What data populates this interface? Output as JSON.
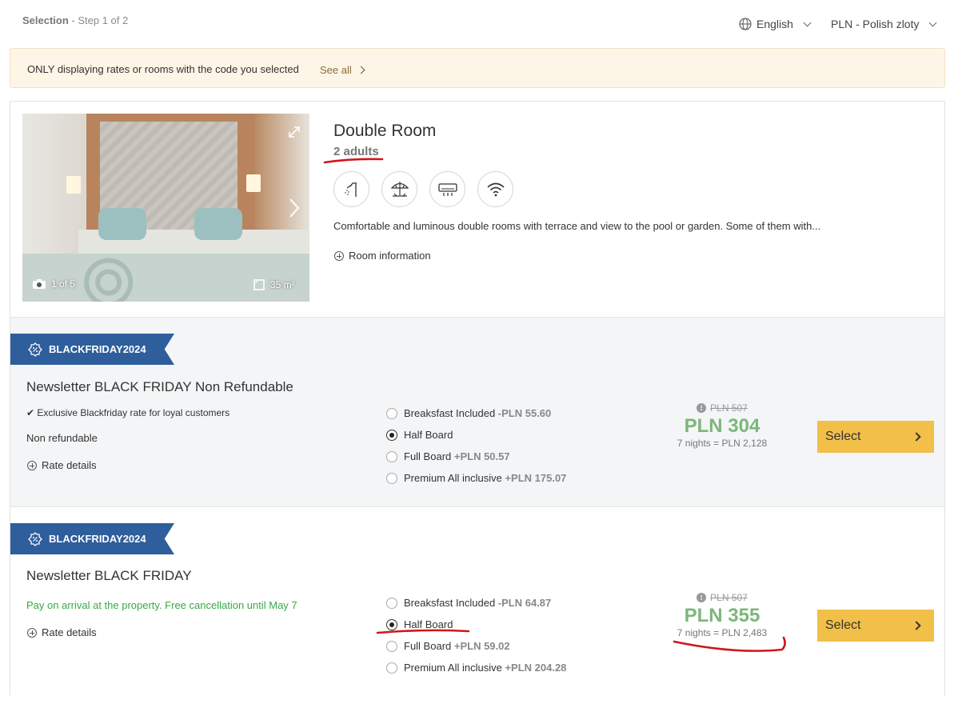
{
  "header": {
    "step_title": "Selection",
    "step_suffix": " - Step 1 of 2",
    "language": "English",
    "currency": "PLN - Polish zloty"
  },
  "notice": {
    "text": "ONLY displaying rates or rooms with the code you selected",
    "link": "See all"
  },
  "room": {
    "title": "Double Room",
    "occupancy": "2 adults",
    "photo_counter": "1 of 5",
    "size": "35 m²",
    "description": "Comfortable and luminous double rooms with terrace and view to the pool or garden.  Some of them with...",
    "info_link": "Room information",
    "amenities": [
      "shower-icon",
      "beach-umbrella-icon",
      "air-conditioning-icon",
      "wifi-icon"
    ]
  },
  "rates": [
    {
      "badge": "BLACKFRIDAY2024",
      "name": "Newsletter BLACK FRIDAY Non Refundable",
      "feature": "Exclusive Blackfriday rate for loyal customers",
      "condition": "Non refundable",
      "details": "Rate details",
      "options": [
        {
          "label": "Breaksfast Included",
          "delta": " -PLN 55.60",
          "selected": false
        },
        {
          "label": "Half Board",
          "delta": "",
          "selected": true
        },
        {
          "label": "Full Board",
          "delta": " +PLN 50.57",
          "selected": false
        },
        {
          "label": "Premium All inclusive",
          "delta": " +PLN 175.07",
          "selected": false
        }
      ],
      "old_price": "PLN 507",
      "price": "PLN 304",
      "total": "7 nights = PLN 2,128",
      "select": "Select"
    },
    {
      "badge": "BLACKFRIDAY2024",
      "name": "Newsletter BLACK FRIDAY",
      "condition": "Pay on arrival at the property. Free cancellation until May 7",
      "details": "Rate details",
      "options": [
        {
          "label": "Breaksfast Included",
          "delta": " -PLN 64.87",
          "selected": false
        },
        {
          "label": "Half Board",
          "delta": "",
          "selected": true
        },
        {
          "label": "Full Board",
          "delta": " +PLN 59.02",
          "selected": false
        },
        {
          "label": "Premium All inclusive",
          "delta": " +PLN 204.28",
          "selected": false
        }
      ],
      "old_price": "PLN 507",
      "price": "PLN 355",
      "total": "7 nights = PLN 2,483",
      "select": "Select"
    }
  ],
  "colors": {
    "ribbon": "#2e5e9c",
    "price_green": "#7cb77a",
    "select_yellow": "#f2bf48",
    "annotation_red": "#d0161b",
    "condition_green": "#3aa748"
  }
}
